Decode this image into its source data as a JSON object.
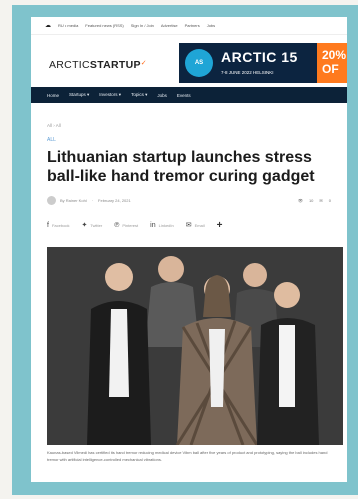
{
  "topbar": {
    "links": [
      "RU • media",
      "Featured news (RSS)",
      "Sign In / Join",
      "Advertise",
      "Partners",
      "Jobs"
    ]
  },
  "brand": {
    "logo_light": "ARCTIC",
    "logo_bold": "STARTUP"
  },
  "banner": {
    "badge": "AS",
    "headline": "ARCTIC 15",
    "dates": "7-8 JUNE 2022 HELSINKI",
    "promo": "20% OF"
  },
  "nav": {
    "items": [
      "Home",
      "Startups ▾",
      "Investors ▾",
      "Topics ▾",
      "Jobs",
      "Events"
    ]
  },
  "article": {
    "breadcrumb": "All › All",
    "category": "ALL",
    "title": "Lithuanian startup launches stress ball-like hand tremor curing gadget",
    "author": "By Rainer Kohl",
    "date": "February 24, 2021",
    "views": "10",
    "comments": "0",
    "share": [
      "Facebook",
      "Twitter",
      "Pinterest",
      "LinkedIn",
      "Email"
    ],
    "caption": "Kaunas-based Vilmedi has certified its hand tremor reducing medical device Vibm ball after five years of product and prototyping, saying the ball includes hand tremor with artificial intelligence-controlled mechanical vibrations."
  },
  "colors": {
    "frame": "#7fc3cc",
    "nav_bg": "#0c2238",
    "accent_orange": "#ff6a1a",
    "banner_bg": "#0c2440",
    "category_blue": "#5a9bd4"
  }
}
